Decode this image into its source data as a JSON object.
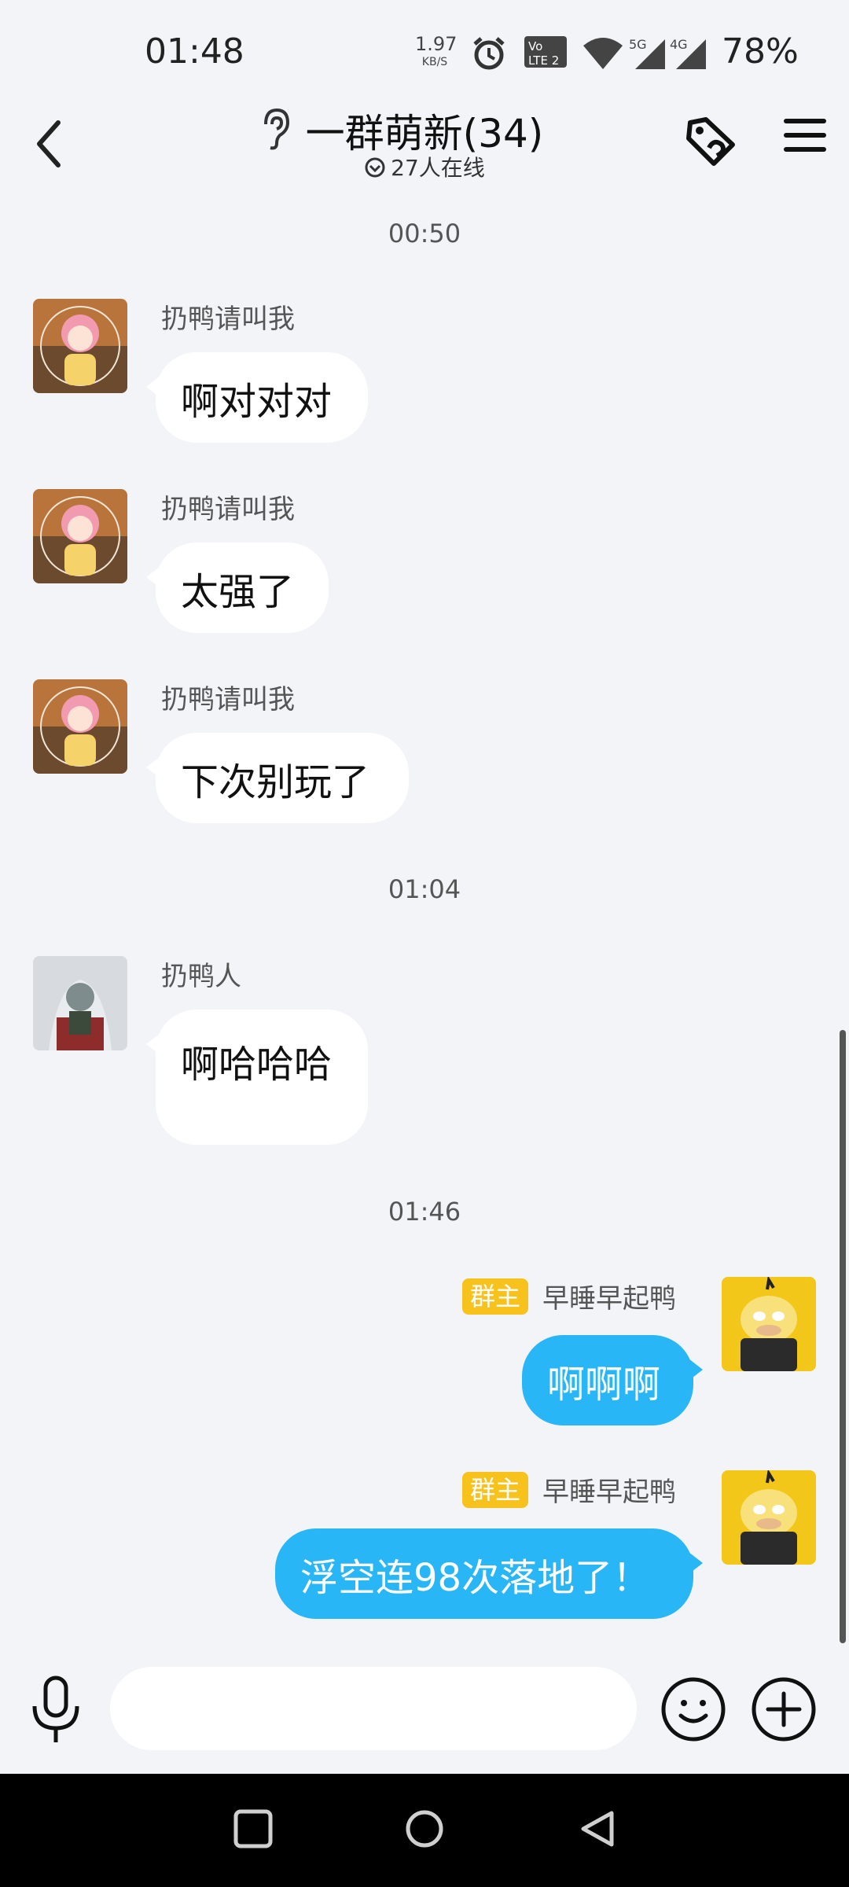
{
  "status_bar": {
    "time": "01:48",
    "net_speed_value": "1.97",
    "net_speed_unit": "KB/S",
    "battery": "78%",
    "icons": [
      "alarm-icon",
      "volte-lte2-icon",
      "wifi-icon",
      "5g-signal-icon",
      "4g-signal-icon"
    ]
  },
  "header": {
    "title": "一群萌新(34)",
    "online": "27人在线",
    "icons": [
      "back-icon",
      "ear-icon",
      "online-status-icon",
      "tag-icon",
      "menu-icon"
    ]
  },
  "chat": {
    "timestamps": [
      "00:50",
      "01:04",
      "01:46"
    ],
    "messages": [
      {
        "sender": "扔鸭请叫我",
        "text": "啊对对对"
      },
      {
        "sender": "扔鸭请叫我",
        "text": "太强了"
      },
      {
        "sender": "扔鸭请叫我",
        "text": "下次别玩了"
      },
      {
        "sender": "扔鸭人",
        "text": "啊哈哈哈"
      },
      {
        "badge": "群主",
        "sender": "早睡早起鸭",
        "text": "啊啊啊"
      },
      {
        "badge": "群主",
        "sender": "早睡早起鸭",
        "text": "浮空连98次落地了！"
      }
    ]
  },
  "input_bar": {
    "placeholder": "",
    "icons": [
      "microphone-icon",
      "emoji-icon",
      "plus-icon"
    ]
  },
  "nav_bar": {
    "icons": [
      "recents-icon",
      "home-icon",
      "back-triangle-icon"
    ]
  },
  "colors": {
    "background": "#f2f4f8",
    "self_bubble": "#29b6f6",
    "owner_badge": "#f8c21c"
  }
}
